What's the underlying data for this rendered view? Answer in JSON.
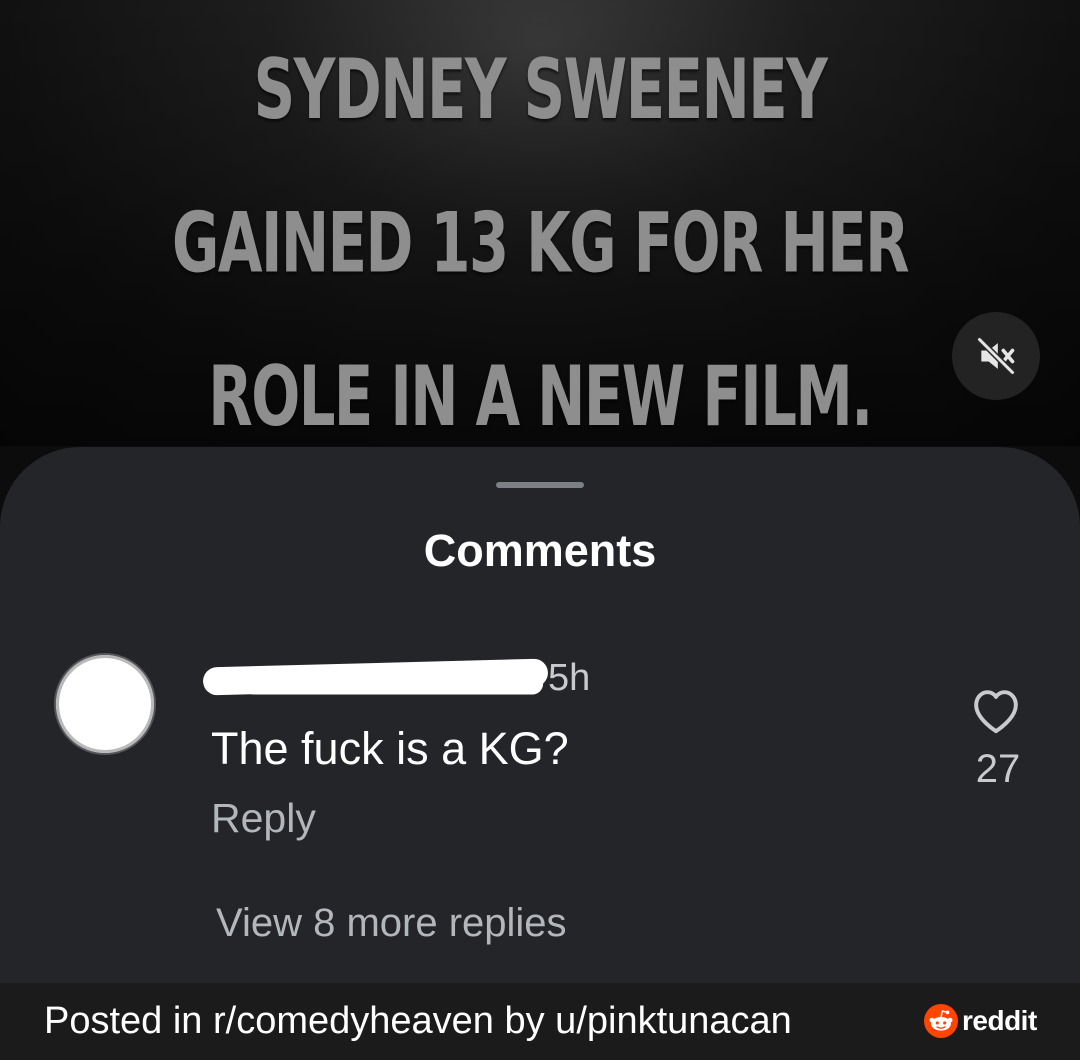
{
  "video": {
    "caption": "SYDNEY SWEENEY GAINED 13 KG FOR HER ROLE IN A NEW FILM.",
    "mute_icon": "speaker-muted-icon"
  },
  "comments_sheet": {
    "title": "Comments",
    "comment": {
      "username": "[redacted]",
      "timestamp": "5h",
      "text": "The fuck is a KG?",
      "reply_label": "Reply",
      "like_icon": "heart-icon",
      "like_count": "27"
    },
    "view_replies_label": "View 8 more replies"
  },
  "footer": {
    "credit": "Posted in r/comedyheaven by u/pinktunacan",
    "brand_word": "reddit",
    "brand_icon": "reddit-snoo-icon",
    "brand_color": "#ff4500"
  }
}
